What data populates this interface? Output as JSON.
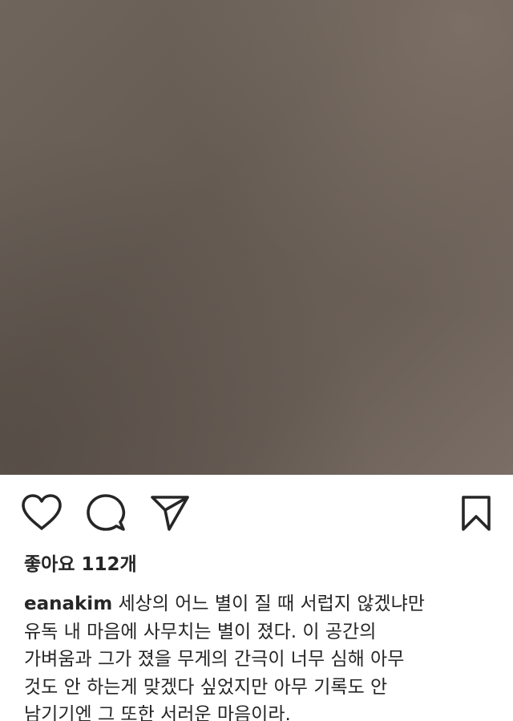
{
  "post": {
    "likes_text": "좋아요 112개",
    "username": "eanakim",
    "caption_lines": [
      "세상의 어느 별이 질 때 서럽지 않겠냐만",
      "유독 내 마음에 사무치는 별이 졌다. 이 공간의",
      "가벼움과 그가 졌을 무게의 간극이 너무 심해 아무",
      "것도 안 하는게 맞겠다 싶었지만 아무 기록도 안",
      "남기기엔 그 또한 서러운 마음이라."
    ]
  },
  "icons": {
    "like": "heart-icon",
    "comment": "comment-bubble-icon",
    "share": "paper-plane-icon",
    "save": "bookmark-icon"
  },
  "colors": {
    "text": "#262626",
    "background": "#ffffff",
    "photo": "#6a5f57"
  }
}
